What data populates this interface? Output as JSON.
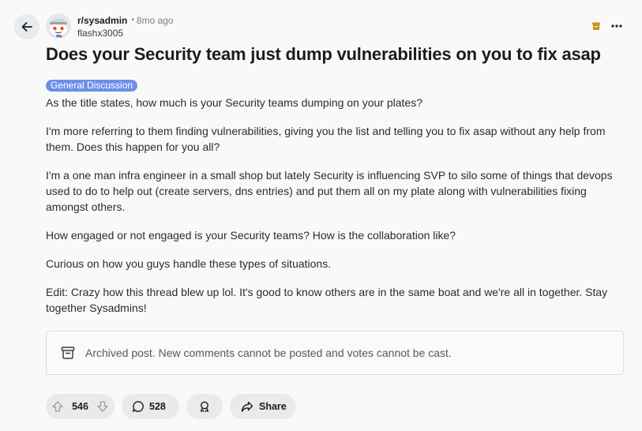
{
  "header": {
    "subreddit": "r/sysadmin",
    "separator": "•",
    "age": "8mo ago",
    "author": "flashx3005"
  },
  "post": {
    "title": "Does your Security team just dump vulnerabilities on you to fix asap",
    "flair": "General Discussion",
    "paragraphs": [
      "As the title states, how much is your Security teams dumping on your plates?",
      "I'm more referring to them finding vulnerabilities, giving you the list and telling you to fix asap without any help from them. Does this happen for you all?",
      "I'm a one man infra engineer in a small shop but lately Security is influencing SVP to silo some of things that devops used to do to help out (create servers, dns entries) and put them all on my plate along with vulnerabilities fixing amongst others.",
      "How engaged or not engaged is your Security teams? How is the collaboration like?",
      "Curious on how you guys handle these types of situations.",
      "Edit: Crazy how this thread blew up lol. It's good to know others are in the same boat and we're all in together. Stay together Sysadmins!"
    ]
  },
  "archived_notice": "Archived post. New comments cannot be posted and votes cannot be cast.",
  "actions": {
    "vote_count": "546",
    "comment_count": "528",
    "share_label": "Share"
  },
  "colors": {
    "flair_bg": "#6d8fe8",
    "archive_badge": "#c8961e",
    "pill_bg": "#e8eaec"
  }
}
